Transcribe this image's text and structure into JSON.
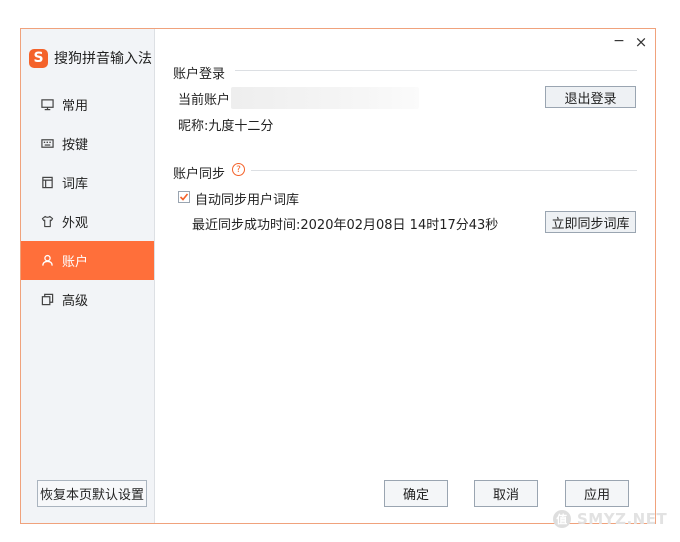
{
  "app": {
    "name": "搜狗拼音输入法",
    "logo_letter": "S"
  },
  "window_controls": {
    "minimize": "−",
    "close": "×"
  },
  "sidebar": {
    "items": [
      {
        "label": "常用",
        "icon": "monitor-icon",
        "active": false
      },
      {
        "label": "按键",
        "icon": "keyboard-icon",
        "active": false
      },
      {
        "label": "词库",
        "icon": "book-icon",
        "active": false
      },
      {
        "label": "外观",
        "icon": "shirt-icon",
        "active": false
      },
      {
        "label": "账户",
        "icon": "user-icon",
        "active": true
      },
      {
        "label": "高级",
        "icon": "layers-icon",
        "active": false
      }
    ],
    "reset_label": "恢复本页默认设置"
  },
  "account_login": {
    "title": "账户登录",
    "current_account_label": "当前账户:",
    "logout_label": "退出登录",
    "nickname": "昵称:九度十二分"
  },
  "account_sync": {
    "title": "账户同步",
    "help_glyph": "?",
    "auto_sync_label": "自动同步用户词库",
    "auto_sync_checked": true,
    "last_sync": "最近同步成功时间:2020年02月08日 14时17分43秒",
    "sync_now_label": "立即同步词库"
  },
  "footer": {
    "ok_label": "确定",
    "cancel_label": "取消",
    "apply_label": "应用"
  },
  "watermark": {
    "badge": "值",
    "text": "SMYZ.NET"
  },
  "colors": {
    "accent": "#ff6f3a",
    "border": "#f0a27c"
  }
}
